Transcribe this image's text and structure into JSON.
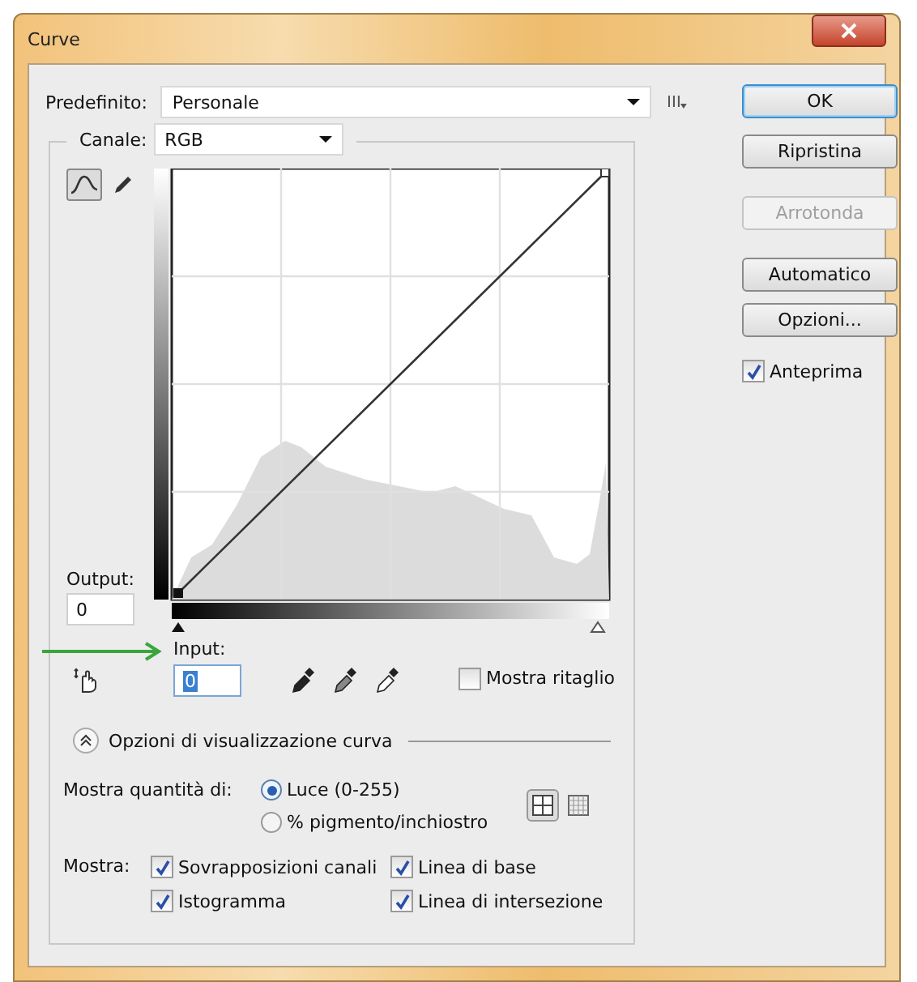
{
  "window": {
    "title": "Curve"
  },
  "preset": {
    "label": "Predefinito:",
    "value": "Personale"
  },
  "channel": {
    "label": "Canale:",
    "value": "RGB"
  },
  "tools": [
    {
      "kind": "curve",
      "selected": true
    },
    {
      "kind": "pencil",
      "selected": false
    }
  ],
  "output": {
    "label": "Output:",
    "value": "0"
  },
  "input": {
    "label": "Input:",
    "value": "0"
  },
  "show_clipping": {
    "label": "Mostra ritaglio",
    "checked": false
  },
  "display_options": {
    "title": "Opzioni di visualizzazione curva",
    "expanded": true
  },
  "show_amount": {
    "label": "Mostra quantità di:",
    "options": [
      {
        "label": "Luce (0-255)",
        "selected": true
      },
      {
        "label": "% pigmento/inchiostro",
        "selected": false
      }
    ]
  },
  "grid_sizes": [
    {
      "kind": "coarse",
      "selected": true
    },
    {
      "kind": "fine",
      "selected": false
    }
  ],
  "show": {
    "label": "Mostra:",
    "options": [
      {
        "label": "Sovrapposizioni canali",
        "checked": true
      },
      {
        "label": "Linea di base",
        "checked": true
      },
      {
        "label": "Istogramma",
        "checked": true
      },
      {
        "label": "Linea di intersezione",
        "checked": true
      }
    ]
  },
  "buttons": [
    {
      "label": "OK",
      "default": true,
      "disabled": false
    },
    {
      "label": "Ripristina",
      "default": false,
      "disabled": false
    },
    {
      "label": "Arrotonda",
      "default": false,
      "disabled": true
    },
    {
      "label": "Automatico",
      "default": false,
      "disabled": false
    },
    {
      "label": "Opzioni...",
      "default": false,
      "disabled": false
    }
  ],
  "preview": {
    "label": "Anteprima",
    "checked": true
  }
}
